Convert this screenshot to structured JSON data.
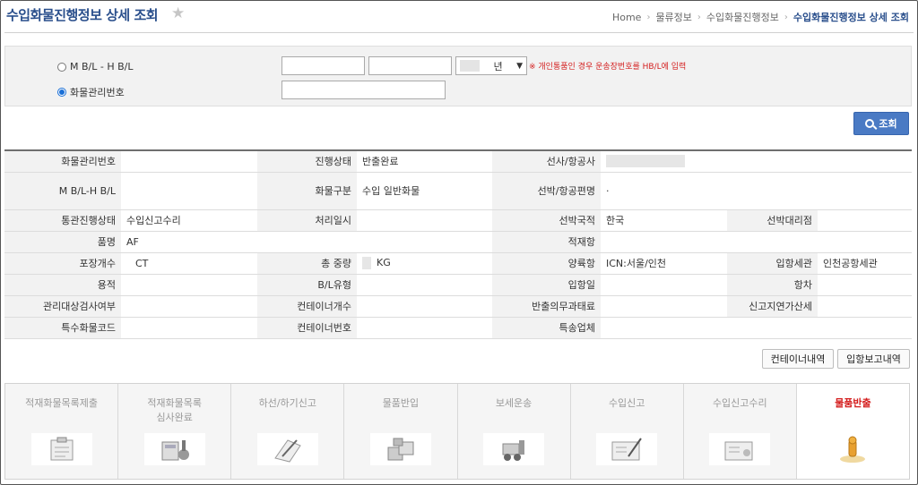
{
  "header": {
    "title": "수입화물진행정보 상세 조회",
    "breadcrumb": [
      "Home",
      "물류정보",
      "수입화물진행정보",
      "수입화물진행정보 상세 조회"
    ]
  },
  "search": {
    "option_bl": "M B/L - H B/L",
    "option_cargo": "화물관리번호",
    "selected": "화물관리번호",
    "year_suffix": "년",
    "notice": "※ 개인통품인 경우 운송장번호를 HB/L에 입력",
    "search_button": "조회"
  },
  "detail": {
    "rows": [
      [
        {
          "h": "화물관리번호",
          "v": ""
        },
        {
          "h": "진행상태",
          "v": "반출완료"
        },
        {
          "h": "선사/항공사",
          "v": ""
        }
      ],
      [
        {
          "h": "M B/L-H B/L",
          "v": ""
        },
        {
          "h": "화물구분",
          "v": "수입 일반화물"
        },
        {
          "h": "선박/항공편명",
          "v": "·"
        }
      ],
      [
        {
          "h": "통관진행상태",
          "v": "수입신고수리"
        },
        {
          "h": "처리일시",
          "v": ""
        },
        {
          "h": "선박국적",
          "v": "한국"
        },
        {
          "h": "선박대리점",
          "v": ""
        }
      ],
      [
        {
          "h": "품명",
          "v": "AF"
        },
        {
          "h": "적재항",
          "v": ""
        }
      ],
      [
        {
          "h": "포장개수",
          "v": "CT"
        },
        {
          "h": "총 중량",
          "v": "KG"
        },
        {
          "h": "양륙항",
          "v": "ICN:서울/인천"
        },
        {
          "h": "입항세관",
          "v": "인천공항세관"
        }
      ],
      [
        {
          "h": "용적",
          "v": ""
        },
        {
          "h": "B/L유형",
          "v": ""
        },
        {
          "h": "입항일",
          "v": ""
        },
        {
          "h": "항차",
          "v": ""
        }
      ],
      [
        {
          "h": "관리대상검사여부",
          "v": ""
        },
        {
          "h": "컨테이너개수",
          "v": ""
        },
        {
          "h": "반출의무과태료",
          "v": ""
        },
        {
          "h": "신고지연가산세",
          "v": ""
        }
      ],
      [
        {
          "h": "특수화물코드",
          "v": ""
        },
        {
          "h": "컨테이너번호",
          "v": ""
        },
        {
          "h": "특송업체",
          "v": ""
        }
      ]
    ]
  },
  "actions": {
    "container_button": "컨테이너내역",
    "arrival_button": "입항보고내역"
  },
  "process": {
    "steps": [
      {
        "label": "적재화물목록제출",
        "icon": "clipboard-icon"
      },
      {
        "label": "적재화물목록\n심사완료",
        "icon": "calculator-stamp-icon"
      },
      {
        "label": "하선/하기신고",
        "icon": "notebook-pen-icon"
      },
      {
        "label": "물품반입",
        "icon": "boxes-icon"
      },
      {
        "label": "보세운송",
        "icon": "forklift-icon"
      },
      {
        "label": "수입신고",
        "icon": "document-pen-icon"
      },
      {
        "label": "수입신고수리",
        "icon": "document-approved-icon"
      },
      {
        "label": "물품반출",
        "icon": "stamp-icon"
      }
    ],
    "active_index": 7
  }
}
